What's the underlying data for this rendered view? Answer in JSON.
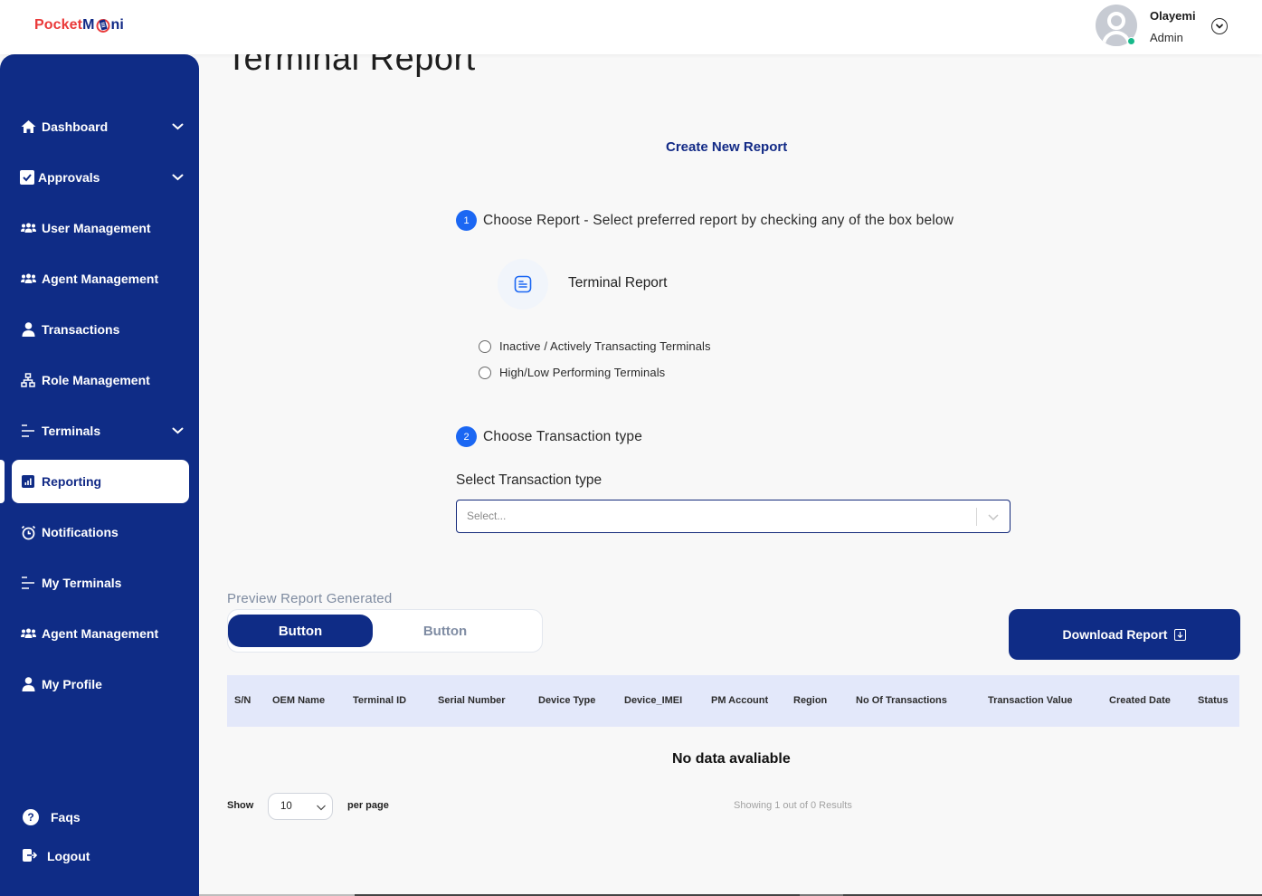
{
  "header": {
    "logo": {
      "part1": "Pocket",
      "part2": "M",
      "part3": "ni"
    },
    "user": {
      "name": "Olayemi",
      "role": "Admin",
      "status": "online"
    }
  },
  "sidebar": {
    "items": [
      {
        "label": "Dashboard",
        "icon": "home-icon",
        "has_chevron": true
      },
      {
        "label": "Approvals",
        "icon": "checkbox-icon",
        "has_chevron": true
      },
      {
        "label": "User Management",
        "icon": "users-icon",
        "has_chevron": false
      },
      {
        "label": "Agent Management",
        "icon": "users-icon",
        "has_chevron": false
      },
      {
        "label": "Transactions",
        "icon": "user-icon",
        "has_chevron": false
      },
      {
        "label": "Role Management",
        "icon": "hierarchy-icon",
        "has_chevron": false
      },
      {
        "label": "Terminals",
        "icon": "lines-icon",
        "has_chevron": true
      },
      {
        "label": "Reporting",
        "icon": "bar-chart-icon",
        "has_chevron": false,
        "active": true
      },
      {
        "label": "Notifications",
        "icon": "alarm-clock-icon",
        "has_chevron": false
      },
      {
        "label": "My Terminals",
        "icon": "lines-icon",
        "has_chevron": false
      },
      {
        "label": "Agent Management",
        "icon": "users-icon",
        "has_chevron": false
      },
      {
        "label": "My Profile",
        "icon": "user-icon",
        "has_chevron": false
      }
    ],
    "bottom": [
      {
        "label": "Faqs",
        "icon": "question-icon"
      },
      {
        "label": "Logout",
        "icon": "logout-icon"
      }
    ]
  },
  "main": {
    "page_title": "Terminal Report",
    "create_title": "Create New Report",
    "step1": {
      "number": "1",
      "text": "Choose Report - Select preferred report by checking any of the box below"
    },
    "report_card": {
      "label": "Terminal Report",
      "icon": "document-icon"
    },
    "report_options": [
      {
        "label": "Inactive / Actively Transacting Terminals",
        "checked": false
      },
      {
        "label": "High/Low Performing Terminals",
        "checked": false
      }
    ],
    "step2": {
      "number": "2",
      "text": "Choose Transaction type"
    },
    "transaction_type": {
      "label": "Select Transaction type",
      "placeholder": "Select...",
      "value": ""
    },
    "preview": {
      "label": "Preview Report Generated",
      "toggle": [
        {
          "label": "Button",
          "active": true
        },
        {
          "label": "Button",
          "active": false
        }
      ],
      "download_label": "Download Report"
    },
    "table": {
      "columns": [
        "S/N",
        "OEM Name",
        "Terminal ID",
        "Serial Number",
        "Device Type",
        "Device_IMEI",
        "PM Account",
        "Region",
        "No Of Transactions",
        "Transaction Value",
        "Created Date",
        "Status"
      ],
      "rows": [],
      "empty_message": "No data avaliable"
    },
    "pagination": {
      "show_label": "Show",
      "per_page_value": "10",
      "per_page_label": "per page",
      "results_text": "Showing 1 out of 0 Results"
    }
  },
  "colors": {
    "primary": "#0f2c86",
    "accent_blue": "#1b67f3",
    "logo_red": "#ea3a3a",
    "table_header_bg": "#e3e8fa",
    "online": "#17b98a"
  }
}
